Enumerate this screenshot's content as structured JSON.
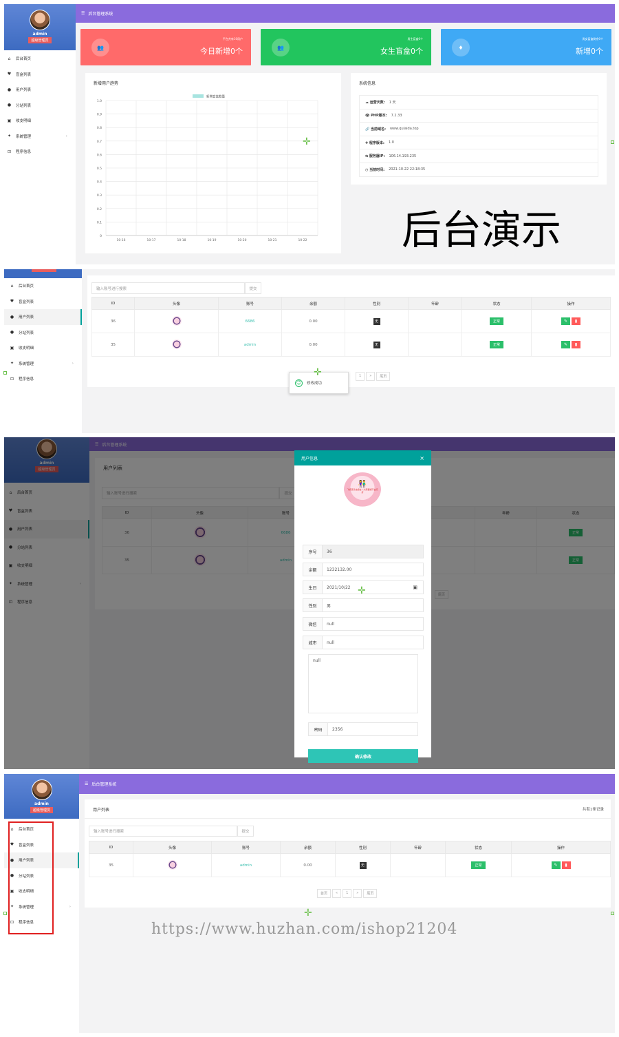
{
  "app": {
    "title": "后台管理系统",
    "user": "admin",
    "role": "超级管理员"
  },
  "menu": {
    "items": [
      {
        "label": "后台首页",
        "icon": "home-icon"
      },
      {
        "label": "盲盒列表",
        "icon": "heart-icon"
      },
      {
        "label": "用户列表",
        "icon": "user-icon"
      },
      {
        "label": "分站列表",
        "icon": "user-icon"
      },
      {
        "label": "收支明细",
        "icon": "wallet-icon"
      },
      {
        "label": "系统管理",
        "icon": "sparkle-icon"
      },
      {
        "label": "程序信息",
        "icon": "terminal-icon"
      }
    ]
  },
  "stats": [
    {
      "small": "平台共有10用户",
      "big": "今日新增0个",
      "color": "#ff6a6a"
    },
    {
      "small": "男生盲盒0个",
      "big": "女生盲盒0个",
      "color": "#22c55e"
    },
    {
      "small": "男女盲盒剩余0个",
      "big": "新增0个",
      "color": "#3fa9f5"
    }
  ],
  "chart_box": {
    "title": "新增用户趋势"
  },
  "chart_data": {
    "type": "line",
    "title": "",
    "legend": [
      "新增盲盒数量"
    ],
    "categories": [
      "10-16",
      "10-17",
      "10-18",
      "10-19",
      "10-20",
      "10-21",
      "10-22"
    ],
    "series": [
      {
        "name": "新增盲盒数量",
        "values": []
      }
    ],
    "ylim": [
      0,
      1.0
    ],
    "yticks": [
      "0",
      "0.1",
      "0.2",
      "0.3",
      "0.4",
      "0.5",
      "0.6",
      "0.7",
      "0.8",
      "0.9",
      "1.0"
    ],
    "grid": true,
    "legend_placement": "top-center"
  },
  "sysinfo": {
    "title": "系统信息",
    "rows": [
      {
        "label": "☁ 运营天数:",
        "value": "1 天"
      },
      {
        "label": "👁 PHP版本:",
        "value": "7.2.33"
      },
      {
        "label": "🔗 当前域名:",
        "value": "www.qulaida.top"
      },
      {
        "label": "✚ 程序版本:",
        "value": "1.0"
      },
      {
        "label": "⇆ 服务器IP:",
        "value": "106.14.193.235"
      },
      {
        "label": "◷ 当前时间:",
        "value": "2021-10-22 22:18:35"
      }
    ]
  },
  "demo_label": "后台演示",
  "search": {
    "placeholder": "输入账号进行搜索",
    "submit": "提交"
  },
  "table": {
    "headers": [
      "ID",
      "头像",
      "账号",
      "余额",
      "性别",
      "年龄",
      "状态",
      "操作"
    ],
    "rows": [
      {
        "id": "36",
        "account": "6686",
        "balance": "0.00",
        "sex": "无",
        "age": "",
        "status": "正常"
      },
      {
        "id": "35",
        "account": "admin",
        "balance": "0.00",
        "sex": "无",
        "age": "",
        "status": "正常"
      }
    ]
  },
  "pager": {
    "first": "首页",
    "prev": "«",
    "page": "1",
    "next": "»",
    "last": "尾页"
  },
  "toast": {
    "text": "修改成功"
  },
  "panel3": {
    "page_title": "用户列表"
  },
  "modal": {
    "title": "用户信息",
    "avatar_text": "飞机耳朵也想去 / 大家都想不去夭折",
    "fields": [
      {
        "label": "序号",
        "value": "36"
      },
      {
        "label": "余额",
        "value": "1232132.00"
      },
      {
        "label": "生日",
        "value": "2021/10/22"
      },
      {
        "label": "性别",
        "value": "男"
      },
      {
        "label": "微信",
        "value": "null"
      },
      {
        "label": "城市",
        "value": "null"
      }
    ],
    "textarea": "null",
    "password_label": "密码",
    "password_value": "2356",
    "confirm": "确认修改"
  },
  "panel4": {
    "page_title": "用户列表",
    "count": "共有1条记录",
    "row": {
      "id": "35",
      "account": "admin",
      "balance": "0.00",
      "sex": "无",
      "age": "",
      "status": "正常"
    }
  },
  "watermark": "https://www.huzhan.com/ishop21204"
}
